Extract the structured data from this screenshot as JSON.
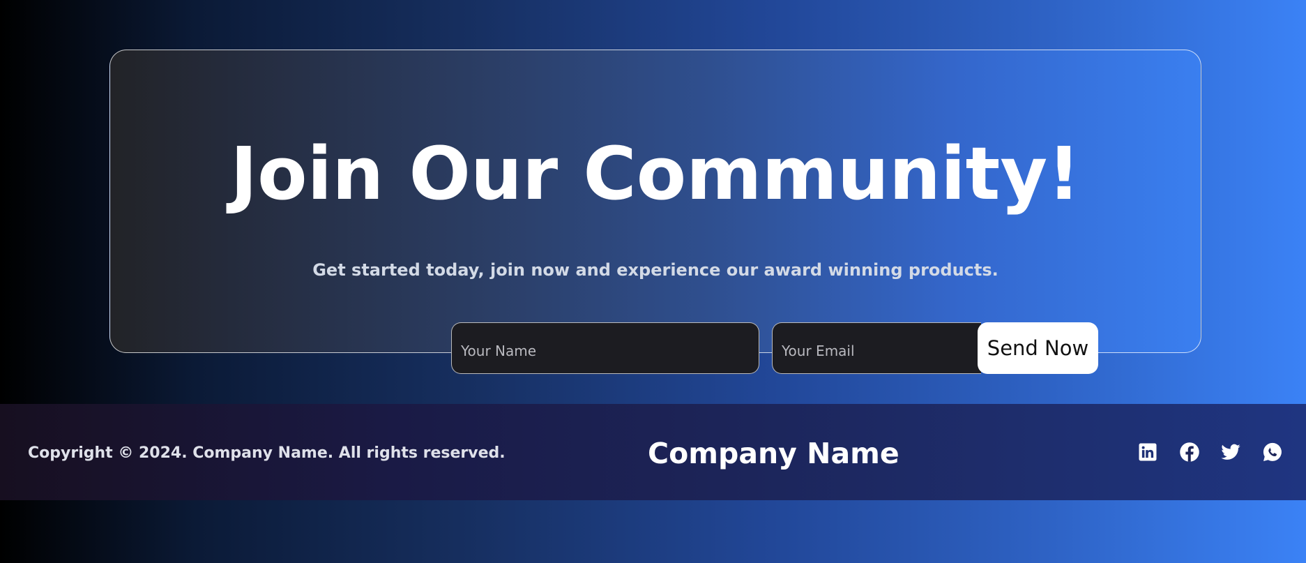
{
  "hero": {
    "title": "Join Our Community!",
    "subtitle": "Get started today, join now and experience our award winning products.",
    "name_placeholder": "Your Name",
    "email_placeholder": "Your Email",
    "submit_label": "Send Now"
  },
  "footer": {
    "copyright": "Copyright © 2024. Company Name. All rights reserved.",
    "brand": "Company Name",
    "social_icons": [
      "linkedin-icon",
      "facebook-icon",
      "twitter-icon",
      "whatsapp-icon"
    ]
  },
  "colors": {
    "accent_blue": "#3b82f6",
    "card_dark": "#222327",
    "input_bg": "#1c1c21",
    "button_bg": "#ffffff",
    "footer_bg": "#1c2458"
  }
}
